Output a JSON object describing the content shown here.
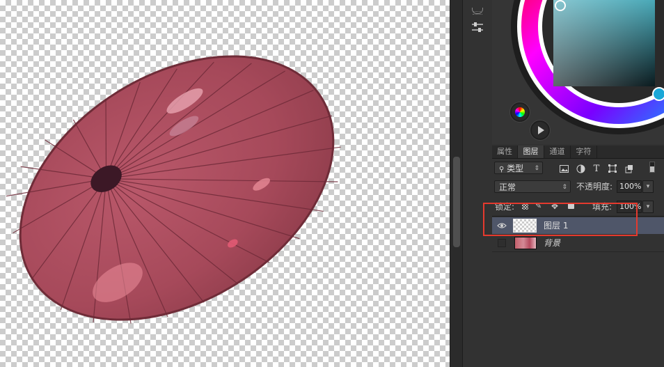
{
  "canvas": {
    "background": "transparent-checkerboard",
    "content": "red-paper-umbrella"
  },
  "toolbar_strip": {
    "icons": [
      "panel-grip-icon",
      "brush-settings-icon"
    ]
  },
  "colors": {
    "accent_highlight": "#e53a2e",
    "selected_layer_bg": "#4f5669",
    "umbrella": "#b5515f"
  },
  "color_wheel": {
    "icons": [
      "color-wheel-icon",
      "play-icon"
    ]
  },
  "panel_tabs": [
    {
      "label": "属性",
      "active": false
    },
    {
      "label": "图层",
      "active": true
    },
    {
      "label": "通道",
      "active": false
    },
    {
      "label": "字符",
      "active": false
    }
  ],
  "layers_panel": {
    "filter_kind": "类型",
    "filter_icons": [
      "image-filter-icon",
      "adjustment-filter-icon",
      "type-filter-icon",
      "shape-filter-icon",
      "smart-object-filter-icon"
    ],
    "blend_mode": "正常",
    "opacity_label": "不透明度:",
    "opacity_value": "100%",
    "lock_label": "锁定:",
    "lock_icons": [
      "lock-pixels-icon",
      "lock-image-icon",
      "lock-position-icon",
      "lock-all-icon"
    ],
    "fill_label": "填充:",
    "fill_value": "100%",
    "layers": [
      {
        "name": "图层 1",
        "visible": true,
        "selected": true
      },
      {
        "name": "背景",
        "visible": false,
        "selected": false
      }
    ]
  }
}
